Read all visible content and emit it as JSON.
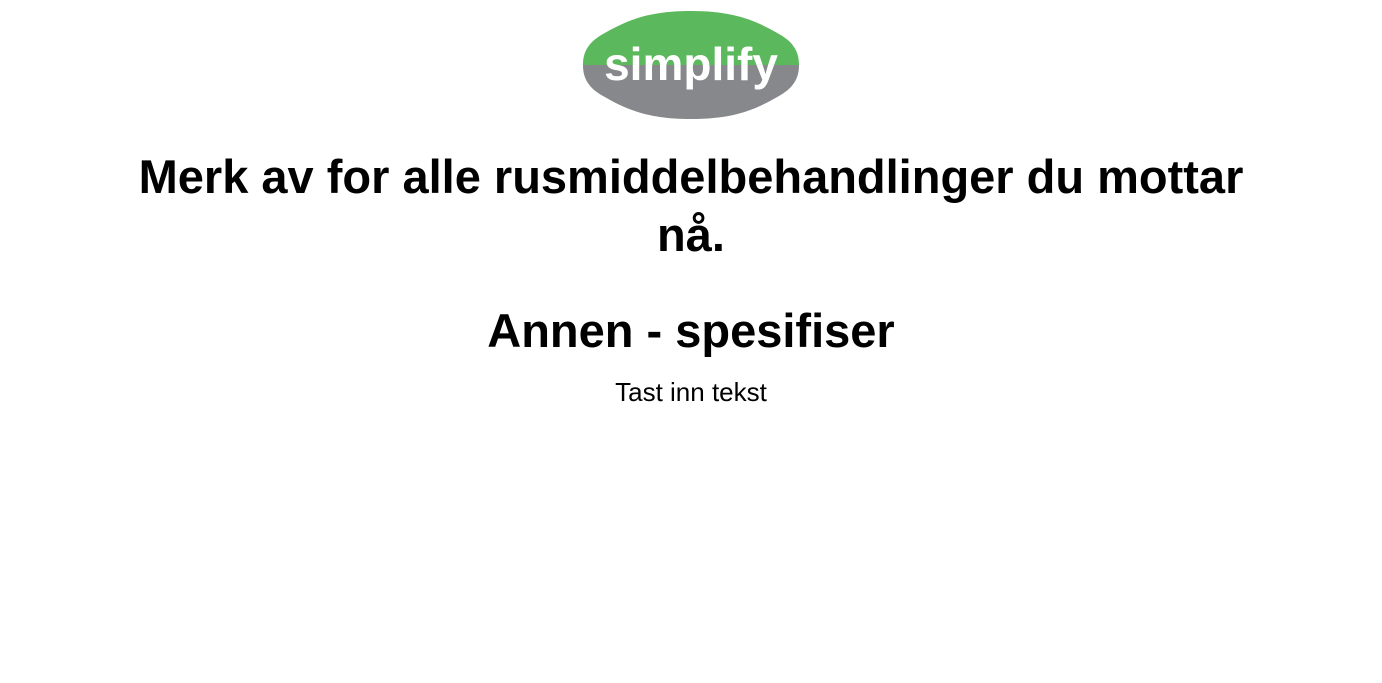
{
  "logo": {
    "text": "simplify",
    "colors": {
      "top": "#5cb85c",
      "bottom": "#87888b",
      "text": "#ffffff"
    }
  },
  "question": {
    "text": "Merk av for alle rusmiddelbehandlinger du mottar nå."
  },
  "option": {
    "label": "Annen - spesifiser"
  },
  "input": {
    "placeholder": "Tast inn tekst",
    "value": ""
  }
}
